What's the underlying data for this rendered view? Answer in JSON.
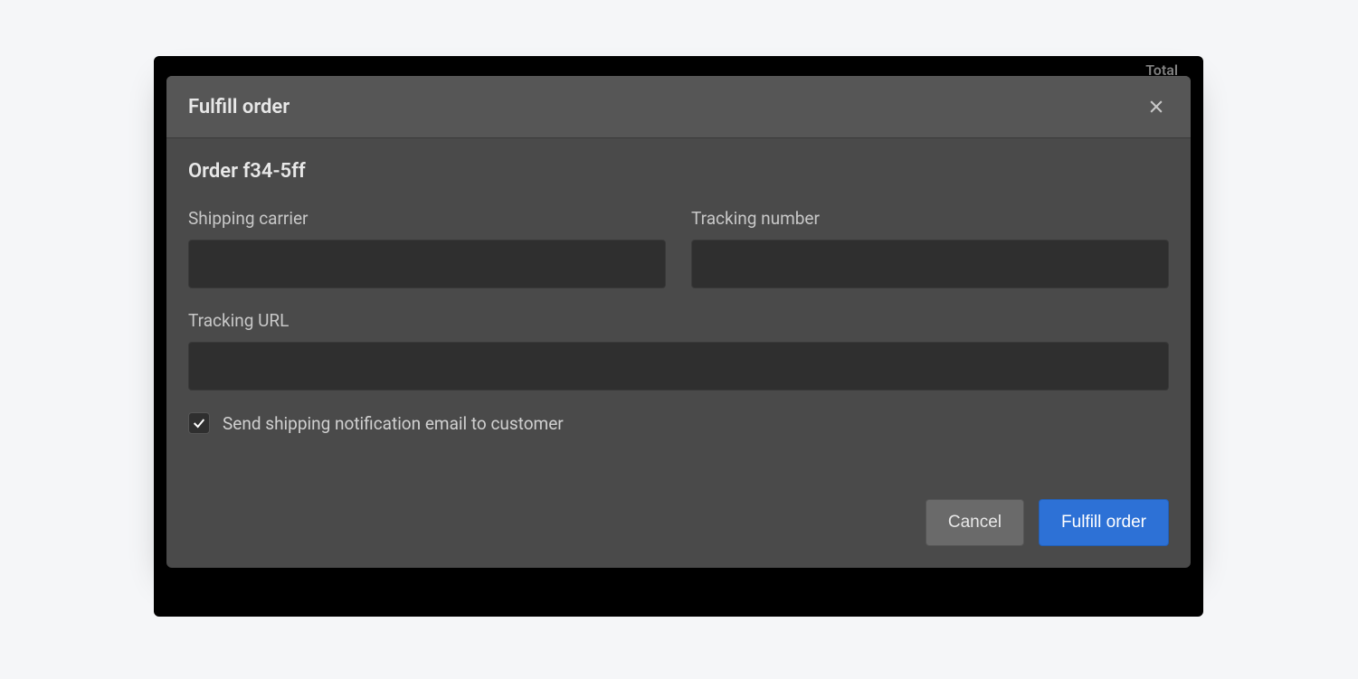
{
  "backdrop": {
    "partial_text": "Total"
  },
  "modal": {
    "title": "Fulfill order",
    "order_heading": "Order f34-5ff",
    "fields": {
      "shipping_carrier": {
        "label": "Shipping carrier",
        "value": ""
      },
      "tracking_number": {
        "label": "Tracking number",
        "value": ""
      },
      "tracking_url": {
        "label": "Tracking URL",
        "value": ""
      }
    },
    "checkbox": {
      "label": "Send shipping notification email to customer",
      "checked": true
    },
    "buttons": {
      "cancel": "Cancel",
      "submit": "Fulfill order"
    }
  }
}
